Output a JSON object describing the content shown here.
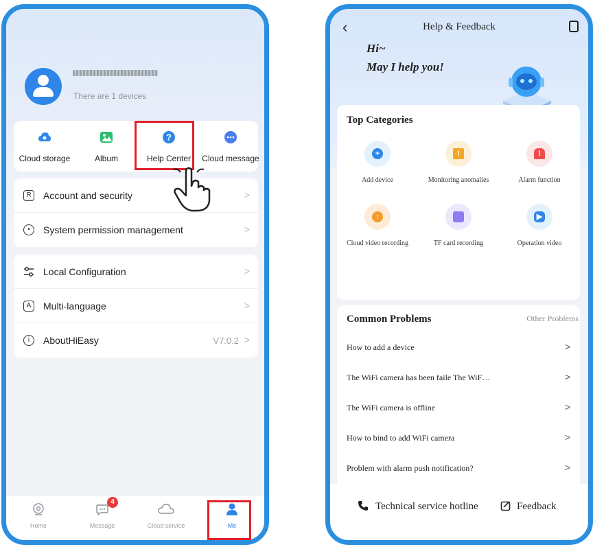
{
  "left": {
    "profile": {
      "device_count": "There are 1 devices"
    },
    "quick": [
      {
        "label": "Cloud storage",
        "icon": "cloud-icon",
        "color": "#2f86e8"
      },
      {
        "label": "Album",
        "icon": "image-icon",
        "color": "#2bbd6e"
      },
      {
        "label": "Help Center",
        "icon": "question-icon",
        "color": "#2f86e8"
      },
      {
        "label": "Cloud message",
        "icon": "chat-icon",
        "color": "#4a7df0"
      }
    ],
    "menu1": [
      {
        "label": "Account and security",
        "icon": "account-icon"
      },
      {
        "label": "System permission management",
        "icon": "permission-icon"
      }
    ],
    "menu2": [
      {
        "label": "Local Configuration",
        "icon": "settings-sliders-icon"
      },
      {
        "label": "Multi-language",
        "icon": "language-icon"
      },
      {
        "label": "AboutHiEasy",
        "icon": "info-icon",
        "version": "V7.0.2"
      }
    ],
    "tabs": [
      {
        "label": "Home"
      },
      {
        "label": "Message",
        "badge": "4"
      },
      {
        "label": "Cloud service"
      },
      {
        "label": "Me"
      }
    ],
    "highlight_color": "#e0202a"
  },
  "right": {
    "title": "Help & Feedback",
    "greeting_line1": "Hi~",
    "greeting_line2": "May I help you!",
    "top_categories_title": "Top Categories",
    "categories": [
      {
        "label": "Add device",
        "icon": "plus-icon",
        "bg": "#e3f1fc",
        "dot": "#2f86e8"
      },
      {
        "label": "Monitoring anomalies",
        "icon": "warning-icon",
        "bg": "#fdf0d8",
        "dot": "#f5a623"
      },
      {
        "label": "Alarm function",
        "icon": "alarm-icon",
        "bg": "#fde6e6",
        "dot": "#ef4c4c"
      },
      {
        "label": "Cloud video recording",
        "icon": "cloud-upload-icon",
        "bg": "#fdebd7",
        "dot": "#f59a2a"
      },
      {
        "label": "TF card recording",
        "icon": "sd-card-icon",
        "bg": "#ebe8fb",
        "dot": "#8b7cf0"
      },
      {
        "label": "Operation video",
        "icon": "play-icon",
        "bg": "#e3f1fc",
        "dot": "#2f86e8"
      }
    ],
    "common_problems_title": "Common Problems",
    "other_problems": "Other Problems",
    "problems": [
      "How to add a device",
      "The WiFi camera has been faile The WiF…",
      "The WiFi camera is offline",
      "How to bind to add WiFi camera",
      "Problem with alarm push notification?"
    ],
    "hotline": "Technical service hotline",
    "feedback": "Feedback"
  }
}
